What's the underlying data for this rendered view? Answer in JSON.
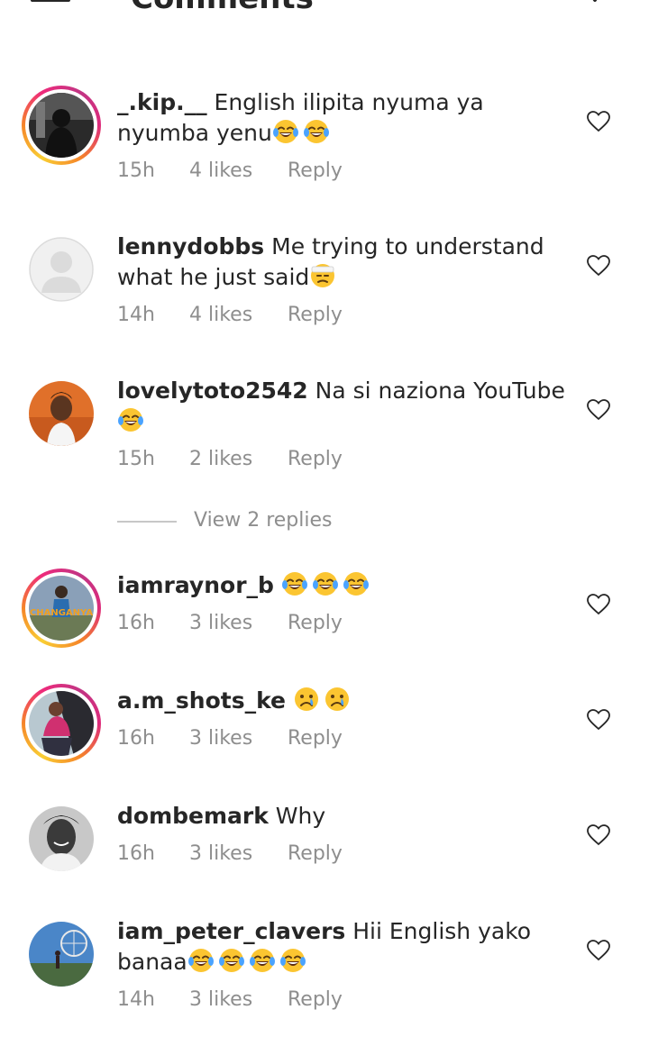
{
  "header": {
    "title": "Comments",
    "back_icon": "arrow-left-icon",
    "send_icon": "send-icon"
  },
  "comments": [
    {
      "username": "_.kip.__",
      "text": " English ilipita nyuma ya nyumba yenu",
      "emojis": [
        "laughing-crying-emoji",
        "laughing-crying-emoji"
      ],
      "time": "15h",
      "likes": "4 likes",
      "reply": "Reply",
      "story_ring": true
    },
    {
      "username": "lennydobbs",
      "text": " Me trying to understand what he just said",
      "emojis": [
        "bandaged-face-emoji"
      ],
      "time": "14h",
      "likes": "4 likes",
      "reply": "Reply",
      "story_ring": false
    },
    {
      "username": "lovelytoto2542",
      "text": " Na si naziona YouTube",
      "emojis": [
        "laughing-crying-emoji"
      ],
      "time": "15h",
      "likes": "2 likes",
      "reply": "Reply",
      "story_ring": false
    },
    {
      "username": "iamraynor_b",
      "text": " ",
      "emojis": [
        "laughing-crying-emoji",
        "laughing-crying-emoji",
        "laughing-crying-emoji"
      ],
      "time": "16h",
      "likes": "3 likes",
      "reply": "Reply",
      "story_ring": true,
      "avatar_caption": "CHANGANYA"
    },
    {
      "username": "a.m_shots_ke",
      "text": " ",
      "emojis": [
        "crying-face-emoji",
        "crying-face-emoji"
      ],
      "time": "16h",
      "likes": "3 likes",
      "reply": "Reply",
      "story_ring": true
    },
    {
      "username": "dombemark",
      "text": " Why",
      "emojis": [],
      "time": "16h",
      "likes": "3 likes",
      "reply": "Reply",
      "story_ring": false
    },
    {
      "username": "iam_peter_clavers",
      "text": " Hii English yako banaa",
      "emojis": [
        "laughing-crying-emoji",
        "laughing-crying-emoji",
        "laughing-crying-emoji",
        "laughing-crying-emoji"
      ],
      "time": "14h",
      "likes": "3 likes",
      "reply": "Reply",
      "story_ring": false
    }
  ],
  "view_replies": {
    "label": "View 2 replies"
  },
  "colors": {
    "meta_gray": "#8e8e8e",
    "text": "#262626",
    "ring_pink": "#ee2a7b",
    "ring_orange": "#f58529"
  }
}
